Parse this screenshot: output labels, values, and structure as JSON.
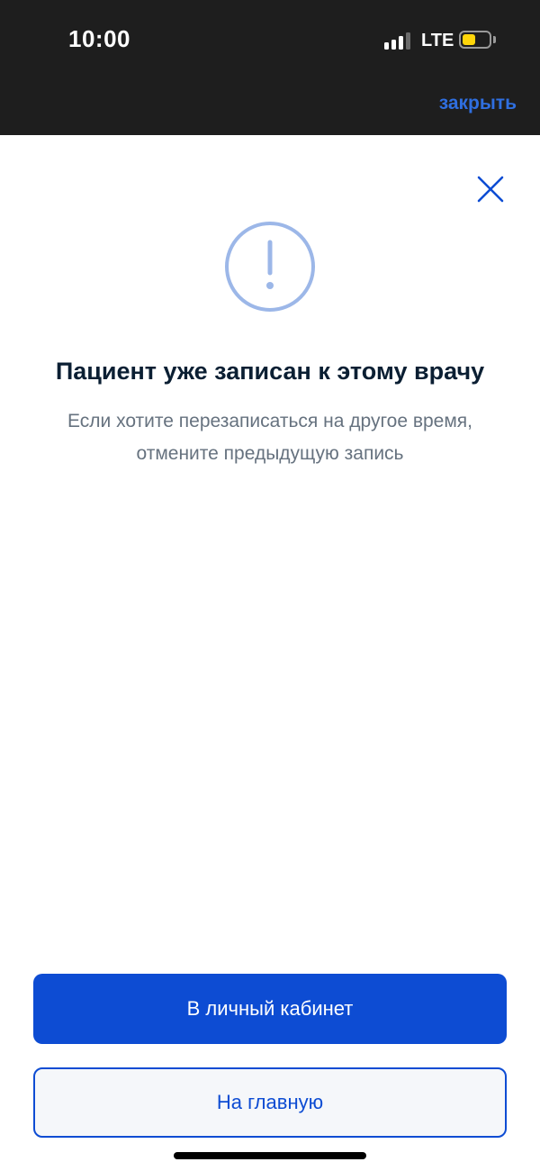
{
  "status_bar": {
    "time": "10:00",
    "network": "LTE",
    "battery_color": "#ffd60a",
    "signal_icon": "signal-bars-icon",
    "battery_icon": "battery-icon"
  },
  "header": {
    "close_link": "закрыть"
  },
  "dialog": {
    "close_icon": "close-icon",
    "alert_icon": "exclamation-circle-icon",
    "title": "Пациент уже записан к этому врачу",
    "subtitle_line1": "Если хотите перезаписаться на другое время,",
    "subtitle_line2": "отмените предыдущую запись"
  },
  "actions": {
    "primary_label": "В личный кабинет",
    "secondary_label": "На главную"
  },
  "colors": {
    "accent": "#0d4cd3",
    "link": "#2f6fe0",
    "title": "#0b1f33",
    "subtitle": "#66727f",
    "alert_icon": "#9cb7e8"
  }
}
